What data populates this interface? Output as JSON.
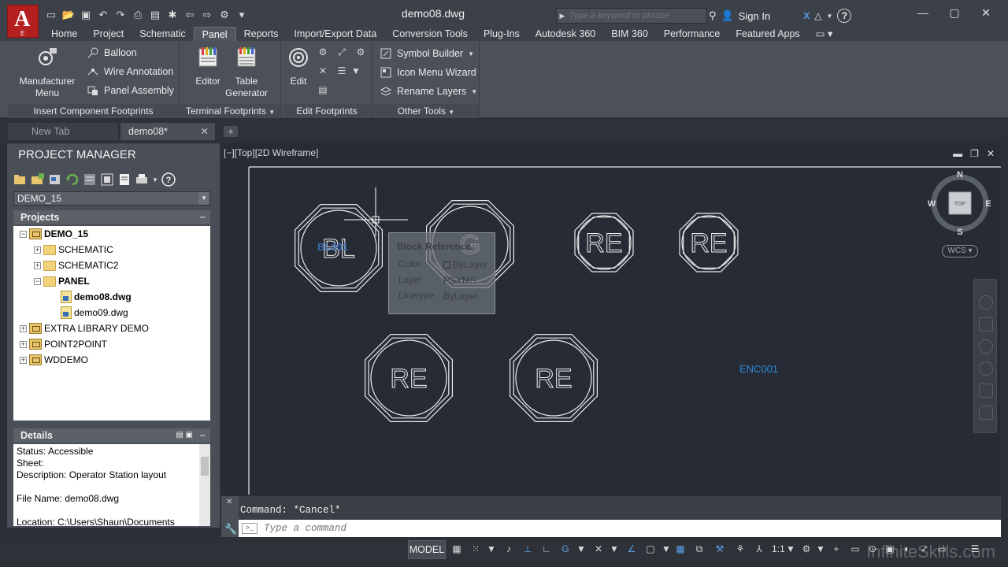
{
  "app": {
    "logo_letter": "A",
    "logo_sub": "E",
    "doc_title": "demo08.dwg",
    "search_placeholder": "Type a keyword or phrase",
    "sign_in": "Sign In"
  },
  "ribbon_tabs": [
    "Home",
    "Project",
    "Schematic",
    "Panel",
    "Reports",
    "Import/Export Data",
    "Conversion Tools",
    "Plug-Ins",
    "Autodesk 360",
    "BIM 360",
    "Performance",
    "Featured Apps"
  ],
  "active_ribbon_tab": "Panel",
  "ribbon": {
    "insert_component": {
      "title": "Insert Component Footprints",
      "manufacturer_menu": "Manufacturer\nMenu",
      "balloon": "Balloon",
      "wire_annotation": "Wire Annotation",
      "panel_assembly": "Panel Assembly"
    },
    "terminal": {
      "title": "Terminal Footprints",
      "editor": "Editor",
      "table_generator": "Table\nGenerator"
    },
    "edit": {
      "title": "Edit Footprints",
      "edit": "Edit"
    },
    "other": {
      "title": "Other Tools",
      "symbol_builder": "Symbol Builder",
      "icon_menu_wizard": "Icon Menu  Wizard",
      "rename_layers": "Rename  Layers"
    }
  },
  "doc_tabs": {
    "new_tab": "New Tab",
    "active": "demo08*"
  },
  "project_manager": {
    "title": "PROJECT MANAGER",
    "selected_project": "DEMO_15",
    "projects_header": "Projects",
    "tree": [
      {
        "label": "DEMO_15",
        "level": 0,
        "type": "project",
        "expander": "−",
        "bold": true
      },
      {
        "label": "SCHEMATIC",
        "level": 1,
        "type": "folder",
        "expander": "+"
      },
      {
        "label": "SCHEMATIC2",
        "level": 1,
        "type": "folder",
        "expander": "+"
      },
      {
        "label": "PANEL",
        "level": 1,
        "type": "folder",
        "expander": "−",
        "bold": true
      },
      {
        "label": "demo08.dwg",
        "level": 2,
        "type": "dwg",
        "expander": "",
        "bold": true
      },
      {
        "label": "demo09.dwg",
        "level": 2,
        "type": "dwg",
        "expander": ""
      },
      {
        "label": "EXTRA LIBRARY DEMO",
        "level": 0,
        "type": "project",
        "expander": "+"
      },
      {
        "label": "POINT2POINT",
        "level": 0,
        "type": "project",
        "expander": "+"
      },
      {
        "label": "WDDEMO",
        "level": 0,
        "type": "project",
        "expander": "+"
      }
    ],
    "details_header": "Details",
    "details": [
      "Status: Accessible",
      "Sheet:",
      "Description: Operator Station layout",
      "",
      "File Name: demo08.dwg",
      "",
      "Location: C:\\Users\\Shaun\\Documents"
    ]
  },
  "viewport": {
    "label": "[−][Top][2D Wireframe]",
    "compass": {
      "n": "N",
      "s": "S",
      "e": "E",
      "w": "W",
      "top": "TOP"
    },
    "wcs": "WCS"
  },
  "drawing": {
    "symbols": [
      {
        "text": "BL"
      },
      {
        "text": "G"
      },
      {
        "text": "RE"
      },
      {
        "text": "RE"
      },
      {
        "text": "RE"
      },
      {
        "text": "RE"
      }
    ],
    "selected_tag": "BL001",
    "enc_label": "ENC001"
  },
  "tooltip": {
    "title": "Block Reference",
    "rows": [
      {
        "key": "Color",
        "value": "ByLayer",
        "swatch": true
      },
      {
        "key": "Layer",
        "value": "PSYMS"
      },
      {
        "key": "Linetype",
        "value": "ByLayer"
      }
    ]
  },
  "command": {
    "history": "Command: *Cancel*",
    "placeholder": "Type a command"
  },
  "status": {
    "model": "MODEL",
    "scale": "1:1"
  },
  "watermark": "InfiniteSkills.com"
}
